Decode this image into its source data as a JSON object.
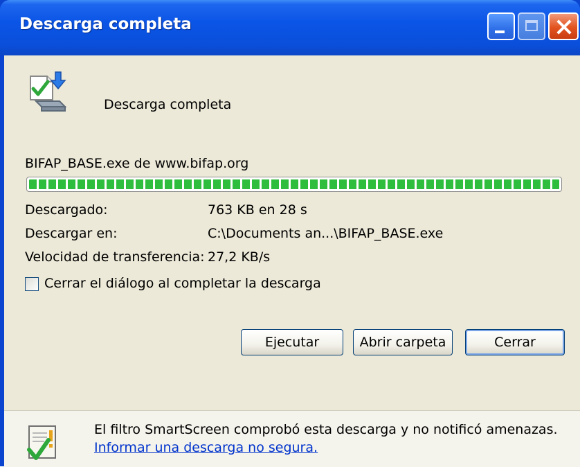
{
  "window": {
    "title": "Descarga completa"
  },
  "header": {
    "message": "Descarga completa"
  },
  "download": {
    "file_line": "BIFAP_BASE.exe de www.bifap.org",
    "progress_fraction": 1.0,
    "rows": [
      {
        "label": "Descargado:",
        "value": "763 KB en 28 s"
      },
      {
        "label": "Descargar en:",
        "value": "C:\\Documents an...\\BIFAP_BASE.exe"
      },
      {
        "label": "Velocidad de transferencia:",
        "value": "27,2 KB/s"
      }
    ],
    "close_checkbox": {
      "label": "Cerrar el diálogo al completar la descarga",
      "checked": false
    }
  },
  "buttons": {
    "run": "Ejecutar",
    "open_folder": "Abrir carpeta",
    "close": "Cerrar"
  },
  "footer": {
    "message": "El filtro SmartScreen comprobó esta descarga y no notificó amenazas.",
    "link": "Informar una descarga no segura."
  },
  "colors": {
    "titlebar": "#0a4fdb",
    "client": "#ece9d8",
    "progress": "#2fbd3d",
    "link": "#0033cc"
  }
}
